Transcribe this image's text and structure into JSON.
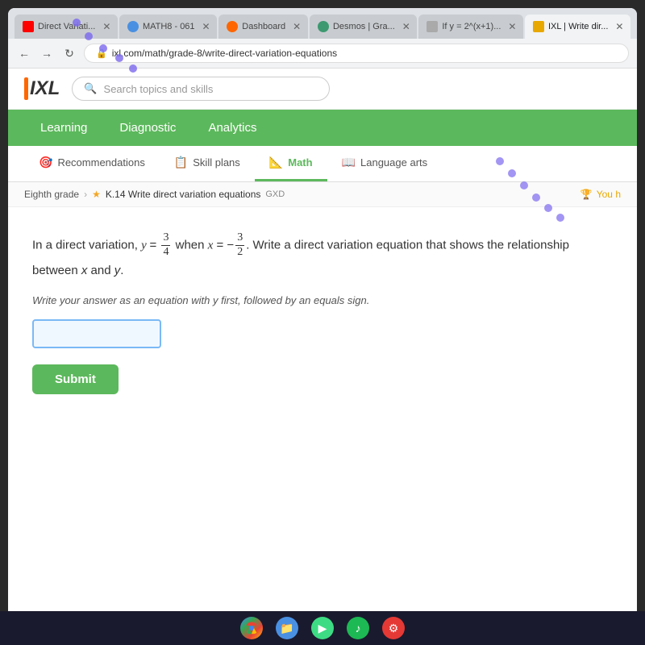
{
  "browser": {
    "tabs": [
      {
        "id": "tab1",
        "label": "Direct Variati...",
        "icon": "youtube",
        "active": false
      },
      {
        "id": "tab2",
        "label": "MATH8 - 061",
        "icon": "math",
        "active": false
      },
      {
        "id": "tab3",
        "label": "Dashboard",
        "icon": "dashboard",
        "active": false
      },
      {
        "id": "tab4",
        "label": "Desmos | Gra...",
        "icon": "desmos",
        "active": false
      },
      {
        "id": "tab5",
        "label": "If y = 2^(x+1)...",
        "icon": "ify",
        "active": false
      },
      {
        "id": "tab6",
        "label": "IXL | Write dir...",
        "icon": "ixl",
        "active": true
      }
    ],
    "address": "ixl.com/math/grade-8/write-direct-variation-equations"
  },
  "ixl": {
    "logo": "IXL",
    "search_placeholder": "Search topics and skills",
    "nav": {
      "items": [
        {
          "label": "Learning",
          "active": false
        },
        {
          "label": "Diagnostic",
          "active": false
        },
        {
          "label": "Analytics",
          "active": false
        }
      ]
    },
    "sub_nav": {
      "items": [
        {
          "label": "Recommendations",
          "icon": "🎯",
          "active": false
        },
        {
          "label": "Skill plans",
          "icon": "📋",
          "active": false
        },
        {
          "label": "Math",
          "icon": "📐",
          "active": true
        },
        {
          "label": "Language arts",
          "icon": "📖",
          "active": false
        }
      ]
    },
    "breadcrumb": {
      "grade": "Eighth grade",
      "skill_label": "K.14 Write direct variation equations",
      "skill_code": "GXD"
    },
    "you_label": "You h",
    "question": {
      "text_part1": "In a direct variation,",
      "var_y": "y",
      "equals1": "=",
      "frac1_num": "3",
      "frac1_den": "4",
      "when": "when",
      "var_x": "x",
      "equals2": "=",
      "neg_sign": "−",
      "frac2_num": "3",
      "frac2_den": "2",
      "text_part2": ". Write a direct variation equation that shows the relationship between x and y.",
      "instruction": "Write your answer as an equation with y first, followed by an equals sign.",
      "input_placeholder": "",
      "submit_label": "Submit"
    }
  },
  "taskbar": {
    "icons": [
      {
        "name": "chrome",
        "label": "Chrome"
      },
      {
        "name": "files",
        "label": "Files"
      },
      {
        "name": "play",
        "label": "Play Store"
      },
      {
        "name": "spotify",
        "label": "Spotify"
      },
      {
        "name": "red-circle",
        "label": "App"
      }
    ]
  },
  "colors": {
    "green": "#5cb85c",
    "blue_tab": "#4a90e2",
    "gold": "#e8a800"
  }
}
